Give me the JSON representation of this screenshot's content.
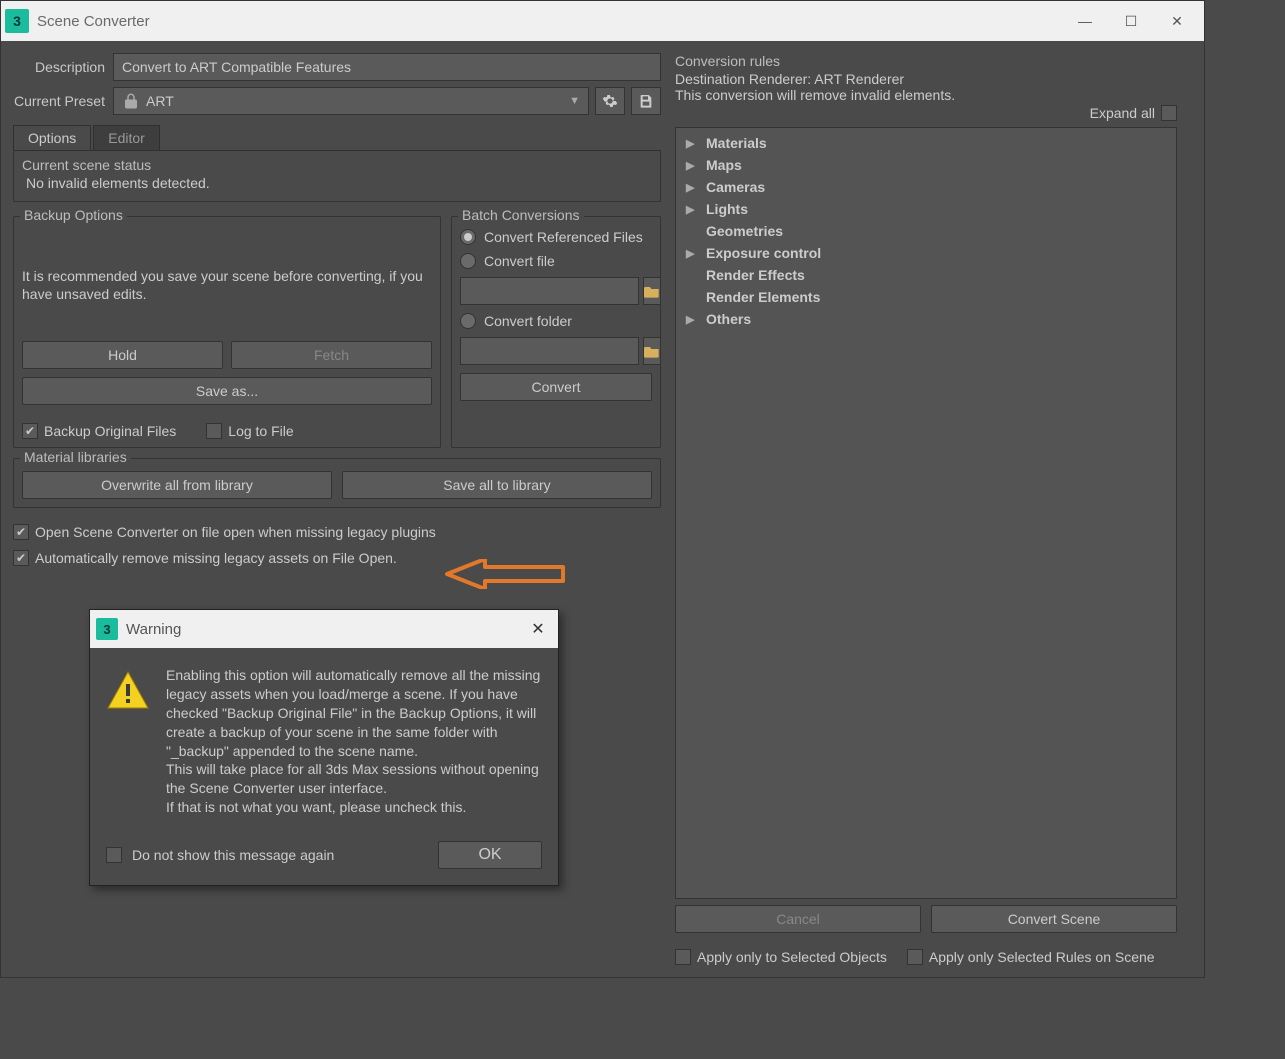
{
  "window": {
    "title": "Scene Converter",
    "minimize": "—",
    "maximize": "☐",
    "close": "✕"
  },
  "left": {
    "description_label": "Description",
    "description_value": "Convert to ART Compatible Features",
    "preset_label": "Current Preset",
    "preset_value": "ART",
    "tabs": {
      "options": "Options",
      "editor": "Editor"
    },
    "status_title": "Current scene status",
    "status_text": "No invalid elements detected.",
    "backup": {
      "title": "Backup Options",
      "hint": "It is recommended you save your scene before converting, if you have unsaved edits.",
      "hold": "Hold",
      "fetch": "Fetch",
      "saveas": "Save as...",
      "backup_original": "Backup Original Files",
      "log": "Log to File"
    },
    "batch": {
      "title": "Batch Conversions",
      "convert_ref": "Convert Referenced Files",
      "convert_file": "Convert file",
      "convert_folder": "Convert folder",
      "convert_btn": "Convert"
    },
    "matlib": {
      "title": "Material libraries",
      "overwrite": "Overwrite all from library",
      "saveall": "Save all to library"
    },
    "open_on_missing": "Open Scene Converter on file open when missing legacy plugins",
    "auto_remove": "Automatically remove missing legacy assets on File Open."
  },
  "right": {
    "header": "Conversion rules",
    "dest": "Destination Renderer: ART Renderer",
    "note": "This conversion will remove invalid elements.",
    "expand_all": "Expand all",
    "items": [
      {
        "label": "Materials",
        "arrow": true
      },
      {
        "label": "Maps",
        "arrow": true
      },
      {
        "label": "Cameras",
        "arrow": true
      },
      {
        "label": "Lights",
        "arrow": true
      },
      {
        "label": "Geometries",
        "arrow": false
      },
      {
        "label": "Exposure control",
        "arrow": true
      },
      {
        "label": "Render Effects",
        "arrow": false
      },
      {
        "label": "Render Elements",
        "arrow": false
      },
      {
        "label": "Others",
        "arrow": true
      }
    ],
    "cancel": "Cancel",
    "convert_scene": "Convert Scene",
    "apply_sel_obj": "Apply only to Selected Objects",
    "apply_sel_rules": "Apply only Selected Rules on Scene"
  },
  "dialog": {
    "title": "Warning",
    "body_p1": "Enabling this option will automatically remove all the missing legacy assets when you load/merge a scene. If you have checked \"Backup Original File\" in the Backup Options, it will create a backup of your scene in the same folder with \"_backup\" appended to the scene name.",
    "body_p2": "This will take place for all 3ds Max sessions without opening the Scene Converter user interface.",
    "body_p3": "If that is not what you want, please uncheck this.",
    "dont_show": "Do not show this message again",
    "ok": "OK"
  }
}
